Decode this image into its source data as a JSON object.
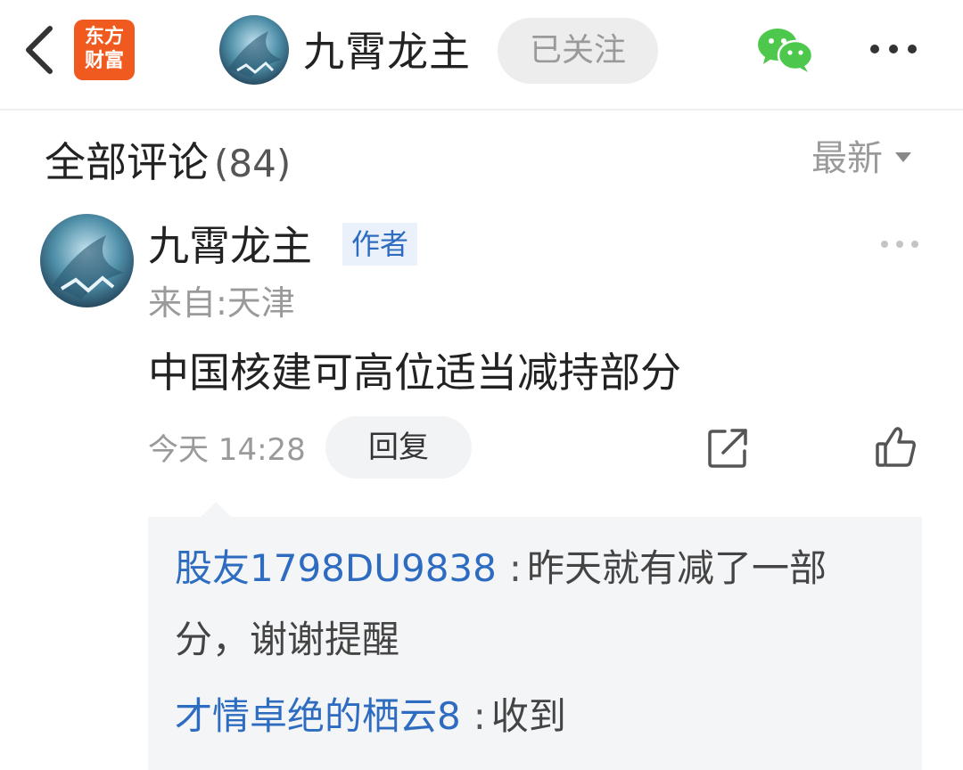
{
  "header": {
    "brand_line1": "东方",
    "brand_line2": "财富",
    "user_name": "九霄龙主",
    "follow_label": "已关注"
  },
  "comments_section": {
    "title": "全部评论",
    "count": "(84)",
    "sort_label": "最新"
  },
  "comment": {
    "user_name": "九霄龙主",
    "author_badge": "作者",
    "location": "来自:天津",
    "content": "中国核建可高位适当减持部分",
    "time": "今天 14:28",
    "reply_label": "回复"
  },
  "replies": [
    {
      "user": "股友1798DU9838",
      "separator": ":",
      "text_line1": "昨天就有减了一部",
      "text_line2": "分，谢谢提醒"
    },
    {
      "user": "才情卓绝的栖云8",
      "separator": ":",
      "text_line1": "收到"
    }
  ],
  "icons": {
    "back": "back-chevron-icon",
    "wechat": "wechat-icon",
    "more": "more-dots-icon",
    "share": "share-icon",
    "like": "thumbs-up-icon"
  },
  "colors": {
    "brand": "#f05a1e",
    "link_blue": "#2d6cc0",
    "wechat_green": "#4dc84d",
    "muted_gray": "#9a9a9a"
  }
}
